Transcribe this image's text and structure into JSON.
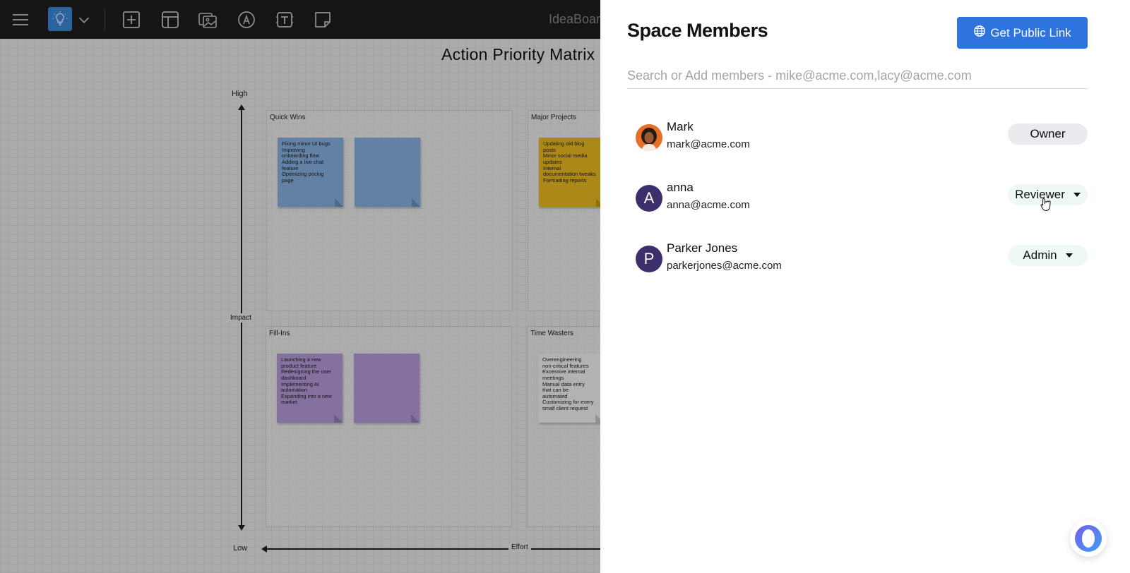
{
  "toolbar": {
    "icons": [
      "menu-icon",
      "lightbulb-logo-icon",
      "chevron-down-icon",
      "add-icon",
      "template-icon",
      "image-gallery-icon",
      "pen-icon",
      "text-icon",
      "sticky-note-icon"
    ],
    "app_name": "IdeaBoar"
  },
  "board": {
    "title": "Action Priority Matrix",
    "y_axis": {
      "high_label": "High",
      "low_label": "Low",
      "name": "Impact"
    },
    "x_axis": {
      "name": "Effort"
    },
    "quadrants": [
      {
        "title": "Quick Wins",
        "notes": [
          {
            "color": "#8fb9ec",
            "lines": [
              "Fixing minor UI bugs",
              "Improving",
              "onboarding flow",
              "Adding a live chat",
              "feature",
              "Optimizing pricing",
              "page"
            ]
          },
          {
            "color": "#8fb9ec",
            "lines": []
          }
        ]
      },
      {
        "title": "Major Projects",
        "notes": [
          {
            "color": "#f7c325",
            "lines": [
              "Updating old blog",
              "posts",
              "Minor social media",
              "updates",
              "Internal",
              "documentation tweaks",
              "Formatting reports"
            ]
          }
        ]
      },
      {
        "title": "Fill-Ins",
        "notes": [
          {
            "color": "#bfa3e6",
            "lines": [
              "Launching a new",
              "product feature",
              "Redesigning the user",
              "dashboard",
              "Implementing AI",
              "automation",
              "Expanding into a new",
              "market"
            ]
          },
          {
            "color": "#bfa3e6",
            "lines": []
          }
        ]
      },
      {
        "title": "Time Wasters",
        "notes": [
          {
            "color": "#ffffff",
            "lines": [
              "Overengineering",
              "non-critical features",
              "Excessive internal",
              "meetings",
              "Manual data entry",
              "that can be",
              "automated",
              "Customizing for every",
              "small client request"
            ]
          }
        ]
      }
    ]
  },
  "panel": {
    "title": "Space Members",
    "public_link_label": "Get Public Link",
    "search_placeholder": "Search or Add members - mike@acme.com,lacy@acme.com",
    "members": [
      {
        "name": "Mark",
        "email": "mark@acme.com",
        "role": "Owner",
        "avatar": "photo",
        "editable": false
      },
      {
        "name": "anna",
        "email": "anna@acme.com",
        "role": "Reviewer",
        "avatar": "A",
        "editable": true
      },
      {
        "name": "Parker Jones",
        "email": "parkerjones@acme.com",
        "role": "Admin",
        "avatar": "P",
        "editable": true
      }
    ]
  },
  "colors": {
    "primary": "#2f73de",
    "avatar_bg": "#3c2f6b",
    "editable_pill": "#eef8f5",
    "owner_pill": "#e9ebee"
  }
}
